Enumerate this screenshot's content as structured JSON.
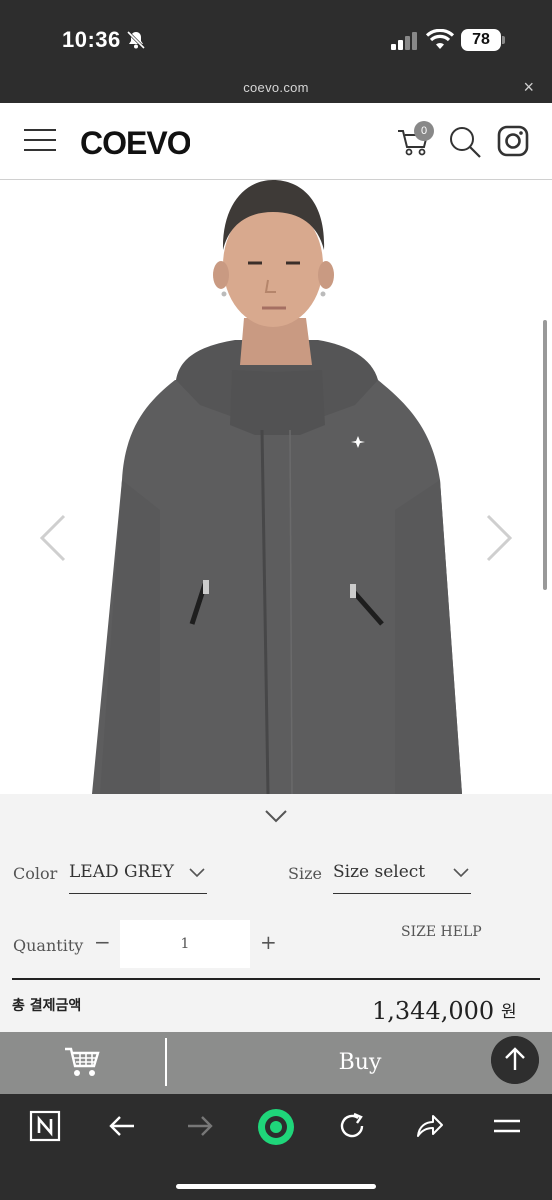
{
  "status_bar": {
    "time": "10:36",
    "battery": "78"
  },
  "url_bar": {
    "url": "coevo.com",
    "close": "×"
  },
  "header": {
    "logo": "COEVO",
    "cart_count": "0"
  },
  "product": {
    "options": {
      "color_label": "Color",
      "color_value": "LEAD GREY",
      "size_label": "Size",
      "size_value": "Size select",
      "quantity_label": "Quantity",
      "quantity_minus": "−",
      "quantity_value": "1",
      "quantity_plus": "+",
      "size_help": "SIZE HELP"
    },
    "total": {
      "label": "총 결제금액",
      "amount": "1,344,000",
      "unit": "원"
    }
  },
  "buy_bar": {
    "buy_label": "Buy"
  },
  "colors": {
    "jacket": "#5d5d5e",
    "panel": "#f3f3f3",
    "buy_bar": "#8c8d8c",
    "toolbar": "#2d2d2d",
    "accent": "#1fd67a"
  },
  "icons": [
    "bell-slash-icon",
    "signal-icon",
    "wifi-icon",
    "hamburger-icon",
    "cart-icon",
    "search-icon",
    "instagram-icon",
    "chevron-left-icon",
    "chevron-right-icon",
    "chevron-down-icon",
    "arrow-up-icon",
    "naver-n-icon",
    "back-icon",
    "forward-icon",
    "reload-icon",
    "share-icon",
    "menu-icon"
  ]
}
